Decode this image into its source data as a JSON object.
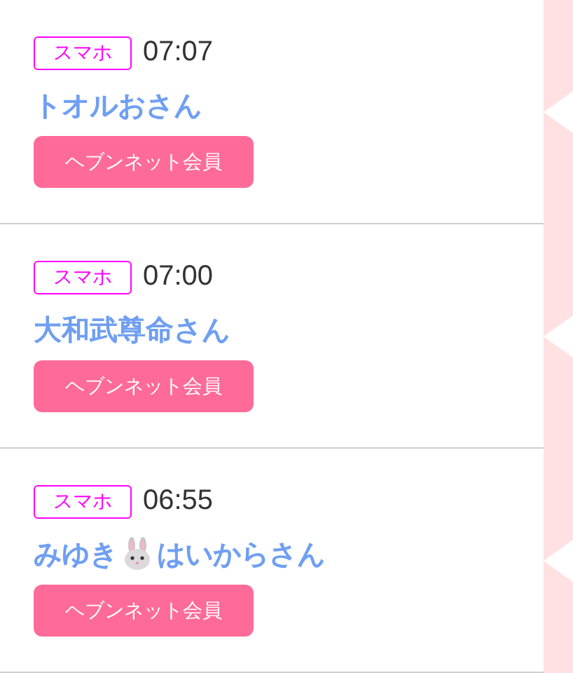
{
  "entries": [
    {
      "device": "スマホ",
      "time": "07:07",
      "name": [
        {
          "kind": "text",
          "text": "トオルおさん"
        }
      ],
      "member_label": "ヘブンネット会員"
    },
    {
      "device": "スマホ",
      "time": "07:00",
      "name": [
        {
          "kind": "text",
          "text": "大和武尊命さん"
        }
      ],
      "member_label": "ヘブンネット会員"
    },
    {
      "device": "スマホ",
      "time": "06:55",
      "name": [
        {
          "kind": "text",
          "text": "みゆき"
        },
        {
          "kind": "rabbit"
        },
        {
          "kind": "text",
          "text": "はいからさん"
        }
      ],
      "member_label": "ヘブンネット会員"
    }
  ]
}
